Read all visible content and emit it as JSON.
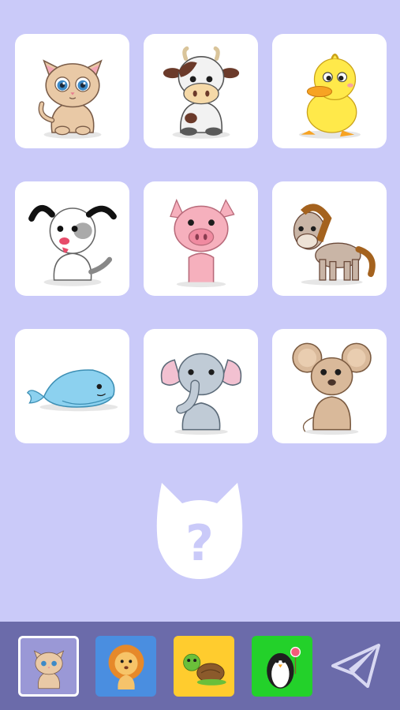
{
  "animal_grid": [
    {
      "name": "kitten",
      "icon": "kitten-icon"
    },
    {
      "name": "cow",
      "icon": "cow-icon"
    },
    {
      "name": "duckling",
      "icon": "duckling-icon"
    },
    {
      "name": "puppy",
      "icon": "puppy-icon"
    },
    {
      "name": "pig",
      "icon": "pig-icon"
    },
    {
      "name": "pony",
      "icon": "pony-icon"
    },
    {
      "name": "whale",
      "icon": "whale-icon"
    },
    {
      "name": "elephant",
      "icon": "elephant-icon"
    },
    {
      "name": "mouse",
      "icon": "mouse-icon"
    }
  ],
  "mystery": {
    "icon": "cat-head-question-icon",
    "symbol": "?"
  },
  "category_bar": {
    "items": [
      {
        "name": "pets",
        "icon": "kitten-icon",
        "color": "#9a98d6",
        "selected": true
      },
      {
        "name": "wild",
        "icon": "lion-icon",
        "color": "#4a8ee0",
        "selected": false
      },
      {
        "name": "reptiles",
        "icon": "turtle-icon",
        "color": "#ffcc2e",
        "selected": false
      },
      {
        "name": "birds",
        "icon": "penguin-icon",
        "color": "#23d12a",
        "selected": false
      }
    ],
    "send_icon": "paper-plane-icon"
  },
  "colors": {
    "background": "#cacaf9",
    "bar": "#6b6baa",
    "tile": "#ffffff"
  }
}
